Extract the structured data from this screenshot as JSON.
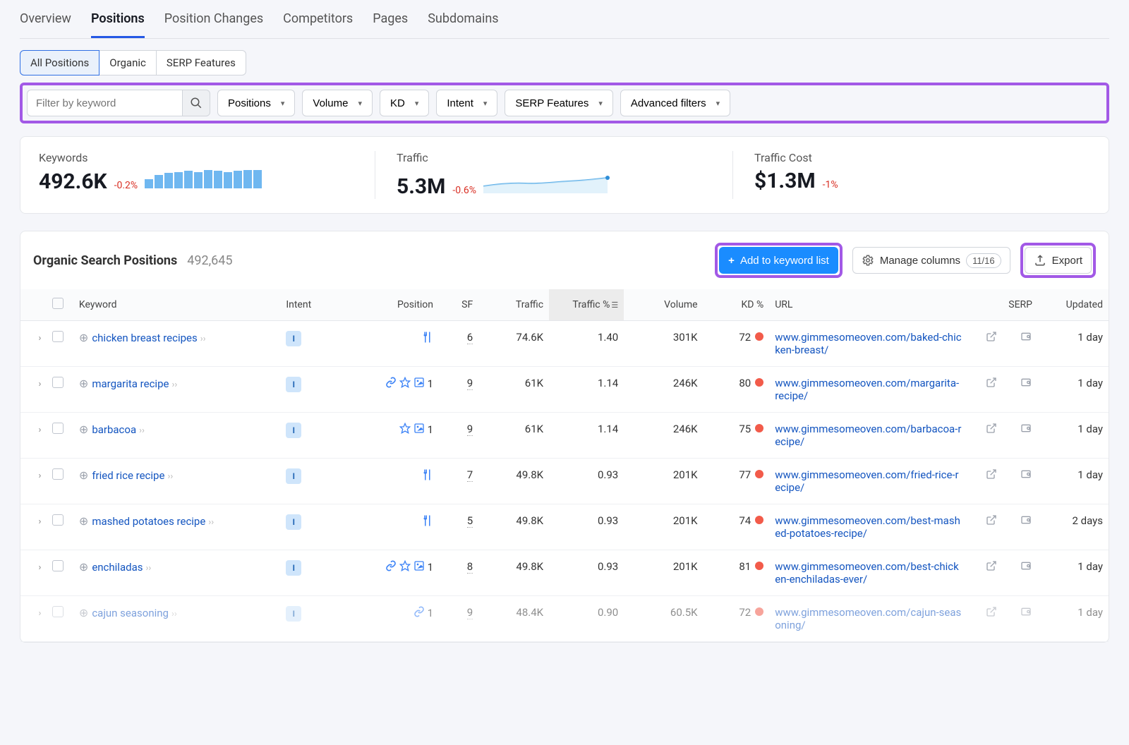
{
  "main_tabs": [
    "Overview",
    "Positions",
    "Position Changes",
    "Competitors",
    "Pages",
    "Subdomains"
  ],
  "main_tab_active": 1,
  "sub_tabs": [
    "All Positions",
    "Organic",
    "SERP Features"
  ],
  "sub_tab_active": 0,
  "filters": {
    "placeholder": "Filter by keyword",
    "dropdowns": [
      "Positions",
      "Volume",
      "KD",
      "Intent",
      "SERP Features",
      "Advanced filters"
    ]
  },
  "metrics": {
    "keywords": {
      "label": "Keywords",
      "value": "492.6K",
      "change": "-0.2%",
      "bars": [
        10,
        15,
        17,
        18,
        19,
        18,
        20,
        19,
        18,
        19,
        20,
        20
      ]
    },
    "traffic": {
      "label": "Traffic",
      "value": "5.3M",
      "change": "-0.6%"
    },
    "traffic_cost": {
      "label": "Traffic Cost",
      "value": "$1.3M",
      "change": "-1%"
    }
  },
  "table": {
    "title": "Organic Search Positions",
    "count": "492,645",
    "add_btn": "Add to keyword list",
    "manage_btn": "Manage columns",
    "manage_count": "11/16",
    "export_btn": "Export",
    "headers": {
      "keyword": "Keyword",
      "intent": "Intent",
      "position": "Position",
      "sf": "SF",
      "traffic": "Traffic",
      "traffic_pct": "Traffic %",
      "volume": "Volume",
      "kd": "KD %",
      "url": "URL",
      "serp": "SERP",
      "updated": "Updated"
    },
    "rows": [
      {
        "keyword": "chicken breast recipes",
        "intent": "I",
        "position_icons": [
          "fork"
        ],
        "position": "",
        "sf": "6",
        "traffic": "74.6K",
        "traffic_pct": "1.40",
        "volume": "301K",
        "kd": "72",
        "url": "www.gimmesomeoven.com/baked-chicken-breast/",
        "updated": "1 day"
      },
      {
        "keyword": "margarita recipe",
        "intent": "I",
        "position_icons": [
          "link",
          "star",
          "image"
        ],
        "position": "1",
        "sf": "9",
        "traffic": "61K",
        "traffic_pct": "1.14",
        "volume": "246K",
        "kd": "80",
        "url": "www.gimmesomeoven.com/margarita-recipe/",
        "updated": "1 day"
      },
      {
        "keyword": "barbacoa",
        "intent": "I",
        "position_icons": [
          "star",
          "image"
        ],
        "position": "1",
        "sf": "9",
        "traffic": "61K",
        "traffic_pct": "1.14",
        "volume": "246K",
        "kd": "75",
        "url": "www.gimmesomeoven.com/barbacoa-recipe/",
        "updated": "1 day"
      },
      {
        "keyword": "fried rice recipe",
        "intent": "I",
        "position_icons": [
          "fork"
        ],
        "position": "",
        "sf": "7",
        "traffic": "49.8K",
        "traffic_pct": "0.93",
        "volume": "201K",
        "kd": "77",
        "url": "www.gimmesomeoven.com/fried-rice-recipe/",
        "updated": "1 day"
      },
      {
        "keyword": "mashed potatoes recipe",
        "intent": "I",
        "position_icons": [
          "fork"
        ],
        "position": "",
        "sf": "5",
        "traffic": "49.8K",
        "traffic_pct": "0.93",
        "volume": "201K",
        "kd": "74",
        "url": "www.gimmesomeoven.com/best-mashed-potatoes-recipe/",
        "updated": "2 days"
      },
      {
        "keyword": "enchiladas",
        "intent": "I",
        "position_icons": [
          "link",
          "star",
          "image"
        ],
        "position": "1",
        "sf": "8",
        "traffic": "49.8K",
        "traffic_pct": "0.93",
        "volume": "201K",
        "kd": "81",
        "url": "www.gimmesomeoven.com/best-chicken-enchiladas-ever/",
        "updated": "1 day"
      },
      {
        "keyword": "cajun seasoning",
        "intent": "I",
        "position_icons": [
          "link"
        ],
        "position": "1",
        "sf": "9",
        "traffic": "48.4K",
        "traffic_pct": "0.90",
        "volume": "60.5K",
        "kd": "72",
        "url": "www.gimmesomeoven.com/cajun-seasoning/",
        "updated": "1 day",
        "faded": true
      }
    ]
  }
}
